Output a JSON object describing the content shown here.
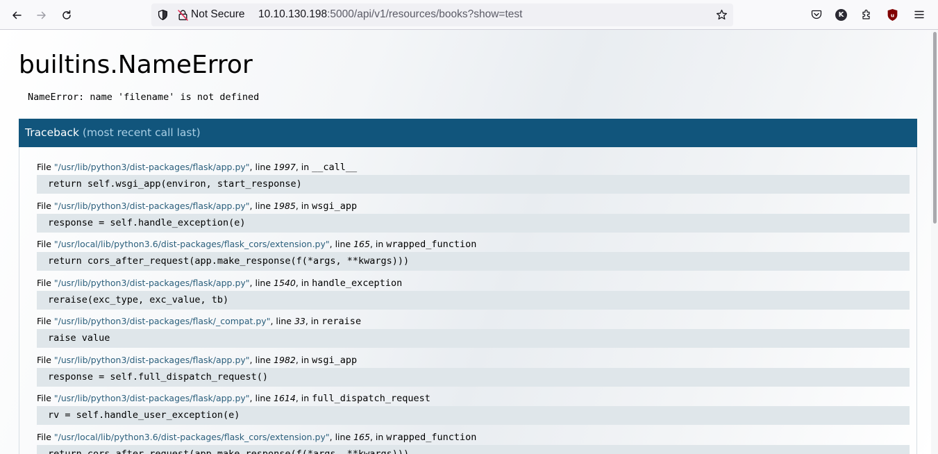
{
  "browser": {
    "security_label": "Not Secure",
    "url_host": "10.10.130.198",
    "url_rest": ":5000/api/v1/resources/books?show=test",
    "account_initial": "K"
  },
  "error": {
    "title": "builtins.NameError",
    "message": "NameError: name 'filename' is not defined"
  },
  "traceback": {
    "label": "Traceback",
    "sublabel": "(most recent call last)",
    "frames": [
      {
        "path": "\"/usr/lib/python3/dist-packages/flask/app.py\"",
        "line": "1997",
        "func": "__call__",
        "code": "return self.wsgi_app(environ, start_response)"
      },
      {
        "path": "\"/usr/lib/python3/dist-packages/flask/app.py\"",
        "line": "1985",
        "func": "wsgi_app",
        "code": "response = self.handle_exception(e)"
      },
      {
        "path": "\"/usr/local/lib/python3.6/dist-packages/flask_cors/extension.py\"",
        "line": "165",
        "func": "wrapped_function",
        "code": "return cors_after_request(app.make_response(f(*args, **kwargs)))"
      },
      {
        "path": "\"/usr/lib/python3/dist-packages/flask/app.py\"",
        "line": "1540",
        "func": "handle_exception",
        "code": "reraise(exc_type, exc_value, tb)"
      },
      {
        "path": "\"/usr/lib/python3/dist-packages/flask/_compat.py\"",
        "line": "33",
        "func": "reraise",
        "code": "raise value"
      },
      {
        "path": "\"/usr/lib/python3/dist-packages/flask/app.py\"",
        "line": "1982",
        "func": "wsgi_app",
        "code": "response = self.full_dispatch_request()"
      },
      {
        "path": "\"/usr/lib/python3/dist-packages/flask/app.py\"",
        "line": "1614",
        "func": "full_dispatch_request",
        "code": "rv = self.handle_user_exception(e)"
      },
      {
        "path": "\"/usr/local/lib/python3.6/dist-packages/flask_cors/extension.py\"",
        "line": "165",
        "func": "wrapped_function",
        "code": "return cors_after_request(app.make_response(f(*args, **kwargs)))"
      }
    ]
  },
  "text": {
    "file_prefix": "File ",
    "line_prefix": ", line ",
    "in_prefix": ", in "
  }
}
